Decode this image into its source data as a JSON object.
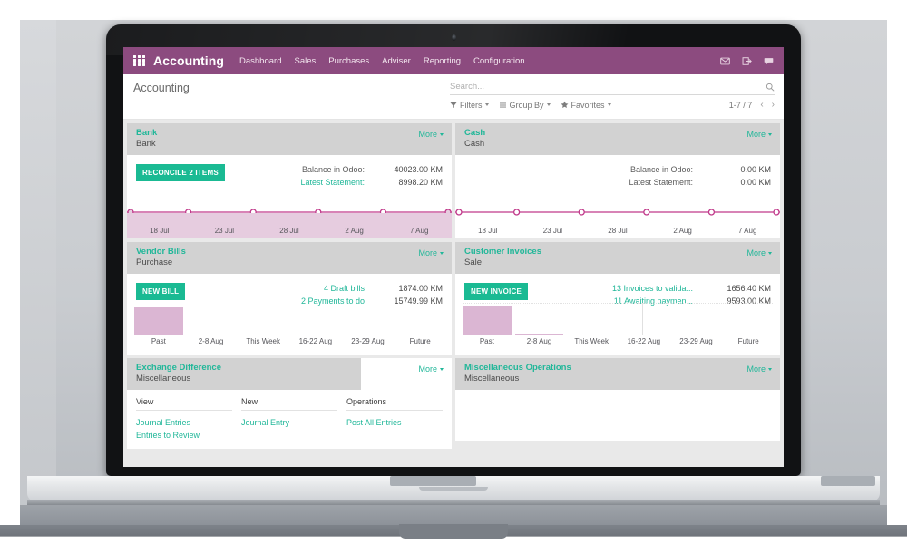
{
  "navbar": {
    "apps_icon": "apps-grid-icon",
    "brand": "Accounting",
    "menus": [
      "Dashboard",
      "Sales",
      "Purchases",
      "Adviser",
      "Reporting",
      "Configuration"
    ],
    "icons": [
      "mail-icon",
      "activity-icon",
      "messages-icon"
    ],
    "bg_color": "#8c4b7f"
  },
  "control_panel": {
    "page_title": "Accounting",
    "search": {
      "value": "",
      "placeholder": "Search..."
    },
    "search_icon": "search-icon",
    "facets": [
      {
        "icon": "filter-icon",
        "label": "Filters"
      },
      {
        "icon": "group-by-icon",
        "label": "Group By"
      },
      {
        "icon": "star-icon",
        "label": "Favorites"
      }
    ],
    "pager": {
      "count": "1-7 / 7",
      "prev": "‹",
      "next": "›"
    }
  },
  "theme": {
    "accent_teal": "#21b799",
    "button_teal": "#1aba93",
    "purple": "#8c4b7f",
    "magenta_line": "#c0398a",
    "pink_fill": "#dbb6d3",
    "card_head_gray": "#d2d2d2"
  },
  "cards": [
    {
      "title": "Bank",
      "subtitle": "Bank",
      "more": "More",
      "button": "RECONCILE 2 ITEMS",
      "rows": [
        {
          "label": "Balance in Odoo:",
          "value": "40023.00 KM",
          "link": false
        },
        {
          "label": "Latest Statement:",
          "value": "8998.20 KM",
          "link": true
        }
      ],
      "chart_ref": 0
    },
    {
      "title": "Cash",
      "subtitle": "Cash",
      "more": "More",
      "button": null,
      "rows": [
        {
          "label": "Balance in Odoo:",
          "value": "0.00 KM",
          "link": false
        },
        {
          "label": "Latest Statement:",
          "value": "0.00 KM",
          "link": false
        }
      ],
      "chart_ref": 1
    },
    {
      "title": "Vendor Bills",
      "subtitle": "Purchase",
      "more": "More",
      "button": "NEW BILL",
      "rows": [
        {
          "label": "4 Draft bills",
          "value": "1874.00 KM",
          "link": true
        },
        {
          "label": "2 Payments to do",
          "value": "15749.99 KM",
          "link": true
        }
      ],
      "chart_ref": 2
    },
    {
      "title": "Customer Invoices",
      "subtitle": "Sale",
      "more": "More",
      "button": "NEW INVOICE",
      "rows": [
        {
          "label": "13 Invoices to valida...",
          "value": "1656.40 KM",
          "link": true
        },
        {
          "label": "11 Awaiting paymen...",
          "value": "9593.00 KM",
          "link": true
        }
      ],
      "chart_ref": 3
    },
    {
      "title": "Exchange Difference",
      "subtitle": "Miscellaneous",
      "more": "More",
      "dropdown": {
        "columns": [
          {
            "header": "View",
            "items": [
              "Journal Entries",
              "Entries to Review"
            ]
          },
          {
            "header": "New",
            "items": [
              "Journal Entry"
            ]
          },
          {
            "header": "Operations",
            "items": [
              "Post All Entries"
            ]
          }
        ]
      }
    },
    {
      "title": "Miscellaneous Operations",
      "subtitle": "Miscellaneous",
      "more": "More"
    }
  ],
  "chart_data": [
    {
      "type": "area",
      "title": "Bank balance sparkline",
      "categories": [
        "18 Jul",
        "23 Jul",
        "28 Jul",
        "2 Aug",
        "7 Aug"
      ],
      "values": [
        0,
        0,
        0,
        0,
        0
      ],
      "xlabel": "",
      "ylabel": "",
      "ylim": [
        0,
        1
      ],
      "grid": false,
      "legend": false,
      "line_color": "#c0398a",
      "fill_color": "#e6ccdf",
      "marker": "circle"
    },
    {
      "type": "line",
      "title": "Cash balance sparkline",
      "categories": [
        "18 Jul",
        "23 Jul",
        "28 Jul",
        "2 Aug",
        "7 Aug"
      ],
      "values": [
        0,
        0,
        0,
        0,
        0
      ],
      "xlabel": "",
      "ylabel": "",
      "ylim": [
        0,
        1
      ],
      "grid": false,
      "legend": false,
      "line_color": "#c0398a",
      "fill_color": "none",
      "marker": "circle"
    },
    {
      "type": "bar",
      "title": "Vendor Bills due",
      "categories": [
        "Past",
        "2-8 Aug",
        "This Week",
        "16-22 Aug",
        "23-29 Aug",
        "Future"
      ],
      "values": [
        100,
        4,
        2,
        2,
        2,
        2
      ],
      "colors": [
        "#dbb6d3",
        "#dbb6d3",
        "#bfe3dc",
        "#bfe3dc",
        "#bfe3dc",
        "#bfe3dc"
      ],
      "xlabel": "",
      "ylabel": "",
      "ylim": [
        0,
        100
      ],
      "grid": false,
      "legend": false
    },
    {
      "type": "bar",
      "title": "Customer Invoices due",
      "categories": [
        "Past",
        "2-8 Aug",
        "This Week",
        "16-22 Aug",
        "23-29 Aug",
        "Future"
      ],
      "values": [
        100,
        5,
        2,
        2,
        3,
        3
      ],
      "colors": [
        "#dbb6d3",
        "#dbb6d3",
        "#bfe3dc",
        "#bfe3dc",
        "#bfe3dc",
        "#bfe3dc"
      ],
      "xlabel": "",
      "ylabel": "",
      "ylim": [
        0,
        100
      ],
      "grid": true,
      "legend": false
    }
  ]
}
